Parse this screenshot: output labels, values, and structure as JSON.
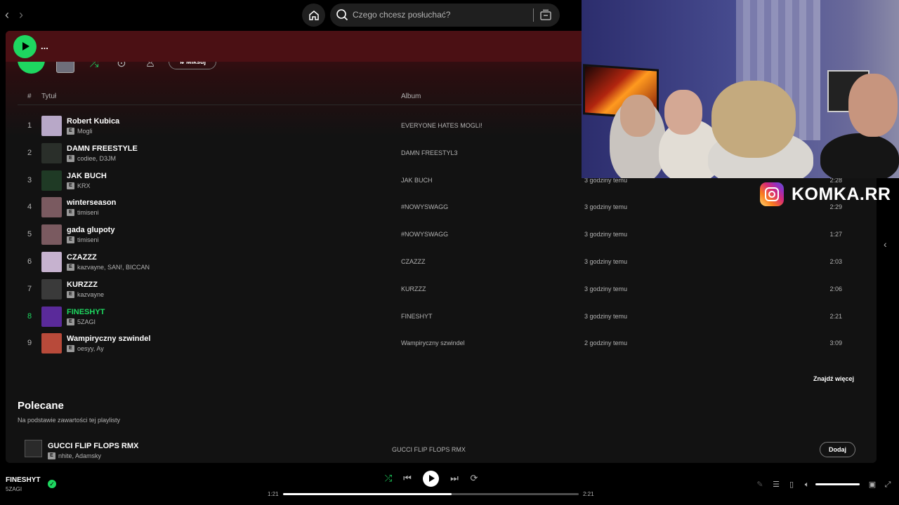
{
  "search": {
    "placeholder": "Czego chcesz posłuchać?"
  },
  "sticky_header": {
    "title": "..."
  },
  "actions": {
    "mix_label": "Miksuj",
    "more_label": "···"
  },
  "table_header": {
    "num": "#",
    "title": "Tytuł",
    "album": "Album"
  },
  "tracks": [
    {
      "num": "1",
      "title": "Robert Kubica",
      "artist": "Mogli",
      "album": "EVERYONE HATES MOGLI!",
      "added": "",
      "duration": "",
      "cover": "#b8a8c8"
    },
    {
      "num": "2",
      "title": "DAMN FREESTYLE",
      "artist": "codiee, D3JM",
      "album": "DAMN FREESTYL3",
      "added": "",
      "duration": "",
      "cover": "#2a2f2a"
    },
    {
      "num": "3",
      "title": "JAK BUCH",
      "artist": "KRX",
      "album": "JAK BUCH",
      "added": "3 godziny temu",
      "duration": "2:28",
      "cover": "#1f3a25"
    },
    {
      "num": "4",
      "title": "winterseason",
      "artist": "timiseni",
      "album": "#NOWYSWAGG",
      "added": "3 godziny temu",
      "duration": "2:29",
      "cover": "#7a5a60"
    },
    {
      "num": "5",
      "title": "gada glupoty",
      "artist": "timiseni",
      "album": "#NOWYSWAGG",
      "added": "3 godziny temu",
      "duration": "1:27",
      "cover": "#7a5a60"
    },
    {
      "num": "6",
      "title": "CZAZZZ",
      "artist": "kazvayne, SAN!, BICCAN",
      "album": "CZAZZZ",
      "added": "3 godziny temu",
      "duration": "2:03",
      "cover": "#c6b2cf"
    },
    {
      "num": "7",
      "title": "KURZZZ",
      "artist": "kazvayne",
      "album": "KURZZZ",
      "added": "3 godziny temu",
      "duration": "2:06",
      "cover": "#3a3a3a"
    },
    {
      "num": "8",
      "title": "FINESHYT",
      "artist": "5ZAGI",
      "album": "FINESHYT",
      "added": "3 godziny temu",
      "duration": "2:21",
      "cover": "#5a2a9a"
    },
    {
      "num": "9",
      "title": "Wampiryczny szwindel",
      "artist": "oesyy, Ay",
      "album": "Wampiryczny szwindel",
      "added": "2 godziny temu",
      "duration": "3:09",
      "cover": "#b84a3a"
    }
  ],
  "active_track_index": 7,
  "explicit_badge": "E",
  "find_more": "Znajdź więcej",
  "recommended": {
    "title": "Polecane",
    "subtitle": "Na podstawie zawartości tej playlisty",
    "items": [
      {
        "title": "GUCCI FLIP FLOPS RMX",
        "artist": "nhite, Adamsky",
        "album": "GUCCI FLIP FLOPS RMX",
        "add_label": "Dodaj"
      }
    ]
  },
  "overlay": {
    "instagram_handle": "KOMKA.RR"
  },
  "player": {
    "title": "FINESHYT",
    "artist": "5ZAGI",
    "time_current": "1:21",
    "time_total": "2:21",
    "progress_fraction": 0.57,
    "volume_fraction": 1.0
  },
  "colors": {
    "accent": "#1ed760",
    "header_red": "#4b1014",
    "background": "#121212"
  }
}
